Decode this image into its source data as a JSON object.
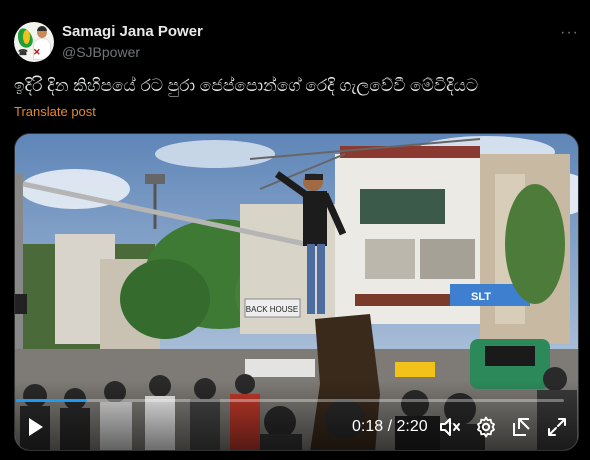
{
  "author": {
    "name": "Samagi Jana Power",
    "handle": "@SJBpower"
  },
  "more_icon": "more-horizontal-icon",
  "post": {
    "text": "ඉදිරි දින කිහිපයේ රට පුරා ජෙප්පොන්ගේ රෙදි ගැලවේවී මේවිදියට",
    "translate_label": "Translate post"
  },
  "video": {
    "time_label": "0:18 / 2:20",
    "progress_fraction": 0.13,
    "controls": [
      "play-icon",
      "mute-icon",
      "settings-gear-icon",
      "pop-out-icon",
      "fullscreen-icon"
    ],
    "sign_text": "BACK HOUSE",
    "shop_sign": "SLT"
  },
  "colors": {
    "accent": "#1d9bf0",
    "translate": "#e38a2b",
    "background": "#000000",
    "text_primary": "#e7e9ea",
    "text_secondary": "#71767b"
  }
}
